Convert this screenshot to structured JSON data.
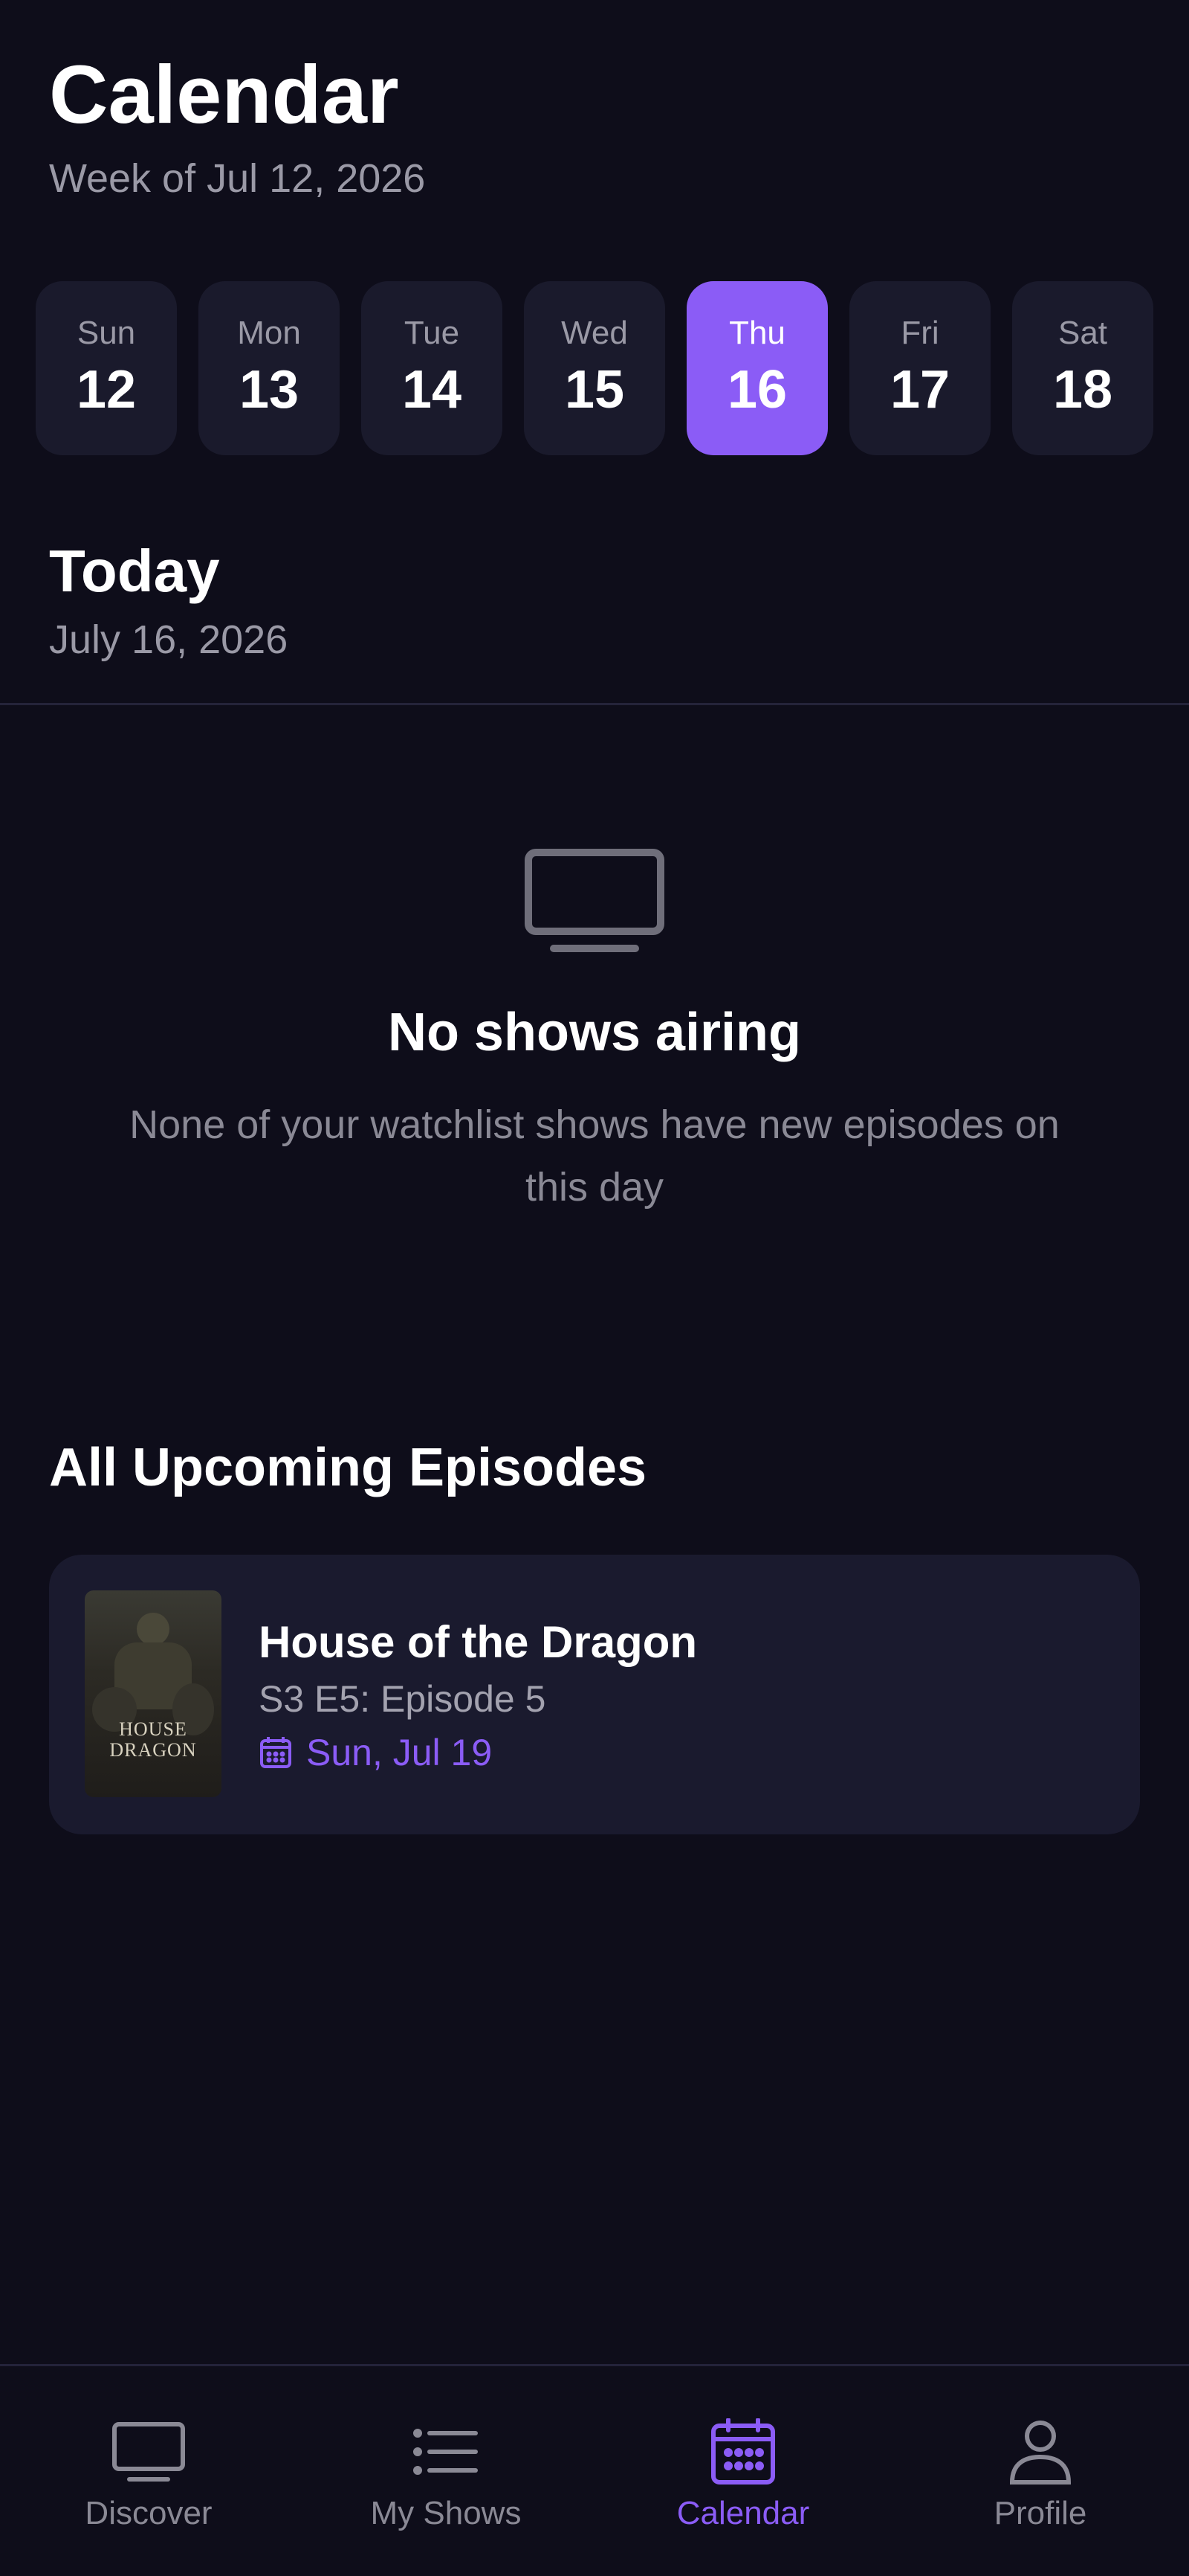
{
  "header": {
    "title": "Calendar",
    "subtitle": "Week of Jul 12, 2026"
  },
  "week": {
    "days": [
      {
        "name": "Sun",
        "num": "12"
      },
      {
        "name": "Mon",
        "num": "13"
      },
      {
        "name": "Tue",
        "num": "14"
      },
      {
        "name": "Wed",
        "num": "15"
      },
      {
        "name": "Thu",
        "num": "16"
      },
      {
        "name": "Fri",
        "num": "17"
      },
      {
        "name": "Sat",
        "num": "18"
      }
    ],
    "selected_index": 4
  },
  "today": {
    "title": "Today",
    "date": "July 16, 2026"
  },
  "empty_state": {
    "icon": "tv-icon",
    "title": "No shows airing",
    "description": "None of your watchlist shows have new episodes on this day"
  },
  "upcoming": {
    "section_title": "All Upcoming Episodes",
    "episodes": [
      {
        "show": "House of the Dragon",
        "episode": "S3 E5: Episode 5",
        "air_date": "Sun, Jul 19",
        "poster_text_line1": "HOUSE",
        "poster_text_line2": "DRAGON"
      }
    ]
  },
  "tabbar": {
    "tabs": [
      {
        "label": "Discover",
        "icon": "tv-icon"
      },
      {
        "label": "My Shows",
        "icon": "list-icon"
      },
      {
        "label": "Calendar",
        "icon": "calendar-icon"
      },
      {
        "label": "Profile",
        "icon": "person-icon"
      }
    ],
    "active_index": 2
  },
  "colors": {
    "background": "#0e0d1a",
    "card": "#1a1a2e",
    "accent": "#8b5cf6",
    "muted_text": "#9a99a6"
  }
}
